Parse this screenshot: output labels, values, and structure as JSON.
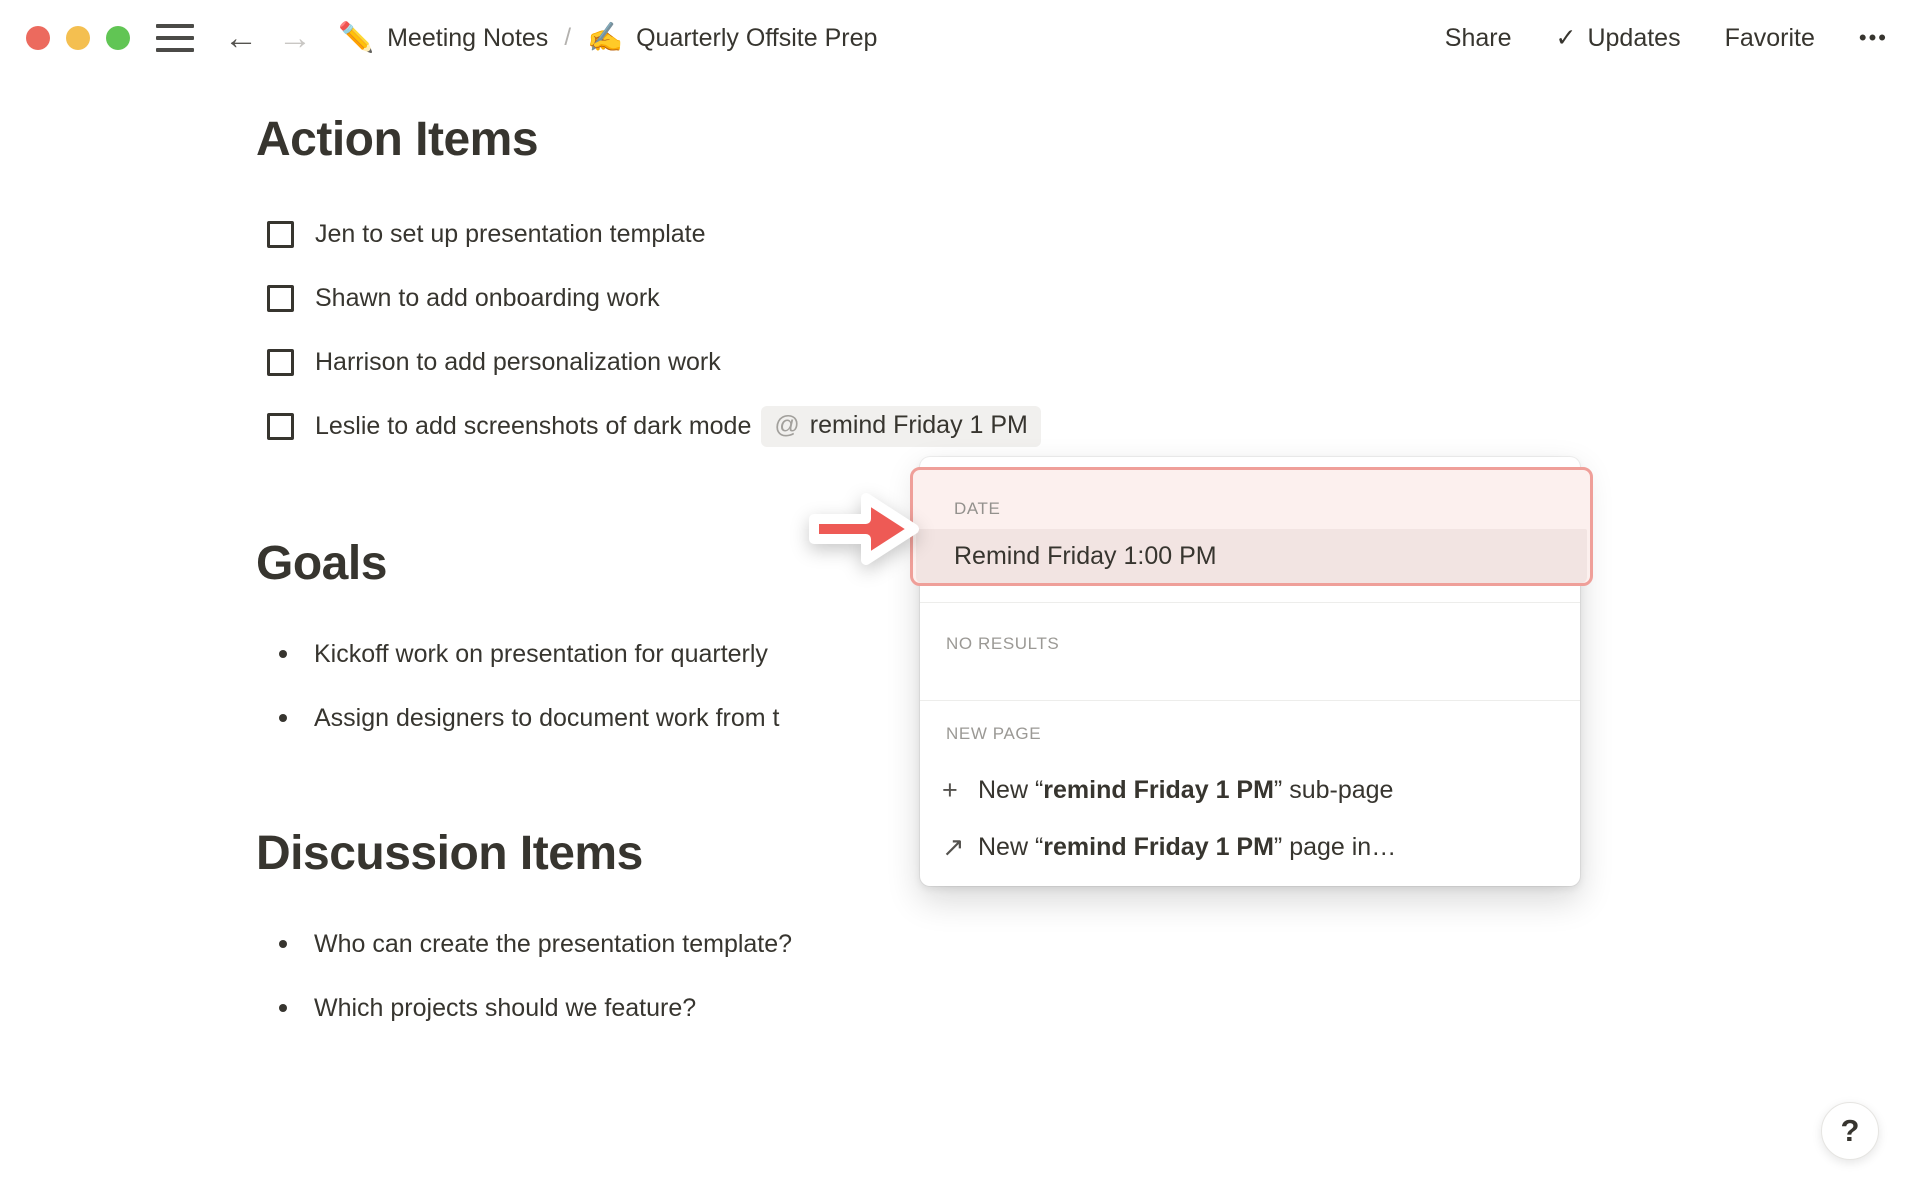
{
  "window": {
    "nav": {
      "back": "←",
      "forward": "→"
    },
    "breadcrumb": {
      "parent_icon": "✏️",
      "parent": "Meeting Notes",
      "separator": "/",
      "current_icon": "✍️",
      "current": "Quarterly Offsite Prep"
    },
    "actions": {
      "share": "Share",
      "updates_check": "✓",
      "updates": "Updates",
      "favorite": "Favorite",
      "more": "•••"
    }
  },
  "doc": {
    "action_items": {
      "heading": "Action Items",
      "todos": [
        "Jen to set up presentation template",
        "Shawn to add onboarding work",
        "Harrison to add personalization work",
        "Leslie to add screenshots of dark mode"
      ],
      "mention": {
        "at": "@",
        "text": "remind Friday 1 PM"
      }
    },
    "goals": {
      "heading": "Goals",
      "bullets": [
        "Kickoff work on presentation for quarterly",
        "Assign designers to document work from t"
      ]
    },
    "discussion": {
      "heading": "Discussion Items",
      "bullets": [
        "Who can create the presentation template?",
        "Which projects should we feature?"
      ]
    }
  },
  "popup": {
    "date_label": "DATE",
    "date_option": "Remind Friday 1:00 PM",
    "no_results_label": "NO RESULTS",
    "new_page_label": "NEW PAGE",
    "options": [
      {
        "icon": "+",
        "prefix": "New “",
        "bold": "remind Friday 1 PM",
        "suffix": "” sub-page"
      },
      {
        "icon": "↗",
        "prefix": "New “",
        "bold": "remind Friday 1 PM",
        "suffix": "” page in…"
      }
    ]
  },
  "help": "?",
  "colors": {
    "text": "#37352f",
    "muted_label": "#9b9995",
    "accent_red": "#ee5a55",
    "annotation_border": "#ef9f99",
    "annotation_bg": "#fcf0ee",
    "selected_row_bg": "#f2e4e2",
    "mention_bg": "#f1f0ee",
    "traffic_red": "#ec6a5e",
    "traffic_yellow": "#f4bf50",
    "traffic_green": "#61c554"
  }
}
